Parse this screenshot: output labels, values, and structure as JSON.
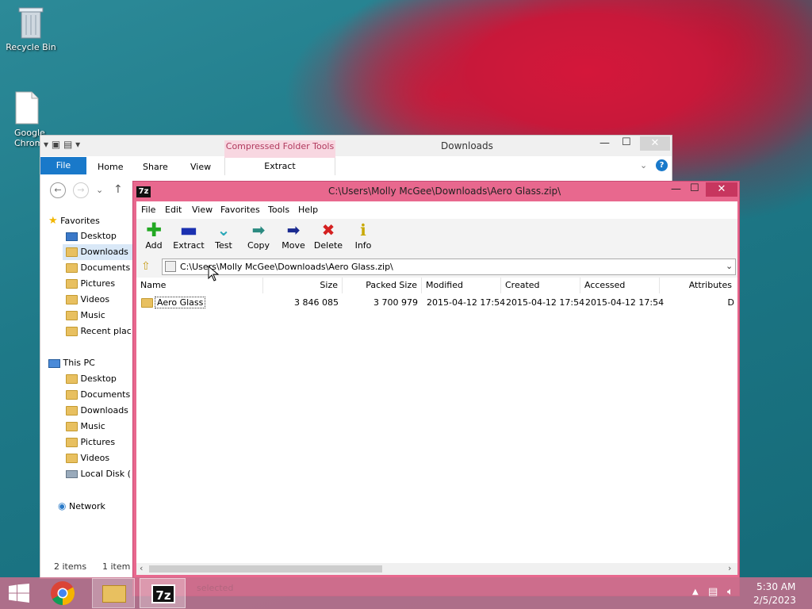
{
  "desktop": {
    "recycle_bin": "Recycle Bin",
    "chrome_label": "Google Chrom"
  },
  "explorer": {
    "title": "Downloads",
    "context_tab": "Compressed Folder Tools",
    "ribbon_tabs": [
      "File",
      "Home",
      "Share",
      "View"
    ],
    "extract_tab": "Extract",
    "nav": {
      "favorites": "Favorites",
      "fav_items": [
        "Desktop",
        "Downloads",
        "Documents",
        "Pictures",
        "Videos",
        "Music",
        "Recent plac"
      ],
      "this_pc": "This PC",
      "pc_items": [
        "Desktop",
        "Documents",
        "Downloads",
        "Music",
        "Pictures",
        "Videos",
        "Local Disk ("
      ],
      "network": "Network"
    },
    "status": {
      "items": "2 items",
      "selected": "1 item"
    }
  },
  "sevenzip": {
    "title": "C:\\Users\\Molly McGee\\Downloads\\Aero Glass.zip\\",
    "menu": [
      "File",
      "Edit",
      "View",
      "Favorites",
      "Tools",
      "Help"
    ],
    "toolbar": {
      "add": "Add",
      "extract": "Extract",
      "test": "Test",
      "copy": "Copy",
      "move": "Move",
      "delete": "Delete",
      "info": "Info"
    },
    "path": "C:\\Users\\Molly McGee\\Downloads\\Aero Glass.zip\\",
    "columns": [
      "Name",
      "Size",
      "Packed Size",
      "Modified",
      "Created",
      "Accessed",
      "Attributes"
    ],
    "rows": [
      {
        "name": "Aero Glass",
        "size": "3 846 085",
        "packed": "3 700 979",
        "modified": "2015-04-12 17:54",
        "created": "2015-04-12 17:54",
        "accessed": "2015-04-12 17:54",
        "attributes": "D"
      }
    ],
    "status": "selected"
  },
  "taskbar": {
    "time": "5:30 AM",
    "date": "2/5/2023"
  },
  "colors": {
    "accent": "#e8688e",
    "ribbon_blue": "#1979ca",
    "sevenzip_border": "#e05a86"
  }
}
